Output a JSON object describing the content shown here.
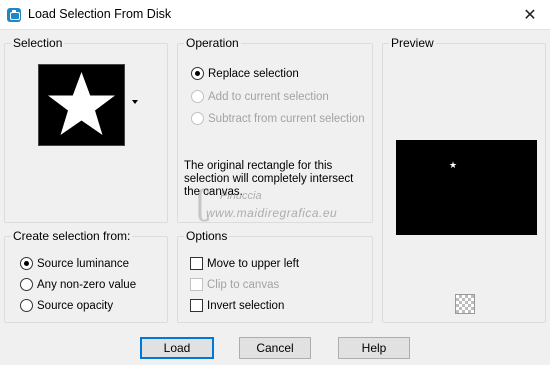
{
  "window": {
    "title": "Load Selection From Disk",
    "close_glyph": "✕",
    "icon": "paintshop-app-icon"
  },
  "selection": {
    "label": "Selection",
    "thumbnail": "white-star-on-black"
  },
  "operation": {
    "label": "Operation",
    "options": [
      {
        "label": "Replace selection",
        "checked": true,
        "enabled": true
      },
      {
        "label": "Add to current selection",
        "checked": false,
        "enabled": false
      },
      {
        "label": "Subtract from current selection",
        "checked": false,
        "enabled": false
      }
    ],
    "info": "The original rectangle for this selection will completely intersect the canvas."
  },
  "preview": {
    "label": "Preview",
    "toggle_icon": "checkerboard-icon"
  },
  "create_from": {
    "label": "Create selection from:",
    "options": [
      {
        "label": "Source luminance",
        "checked": true
      },
      {
        "label": "Any non-zero value",
        "checked": false
      },
      {
        "label": "Source opacity",
        "checked": false
      }
    ]
  },
  "options": {
    "label": "Options",
    "items": [
      {
        "label": "Move to upper left",
        "checked": false,
        "enabled": true
      },
      {
        "label": "Clip to canvas",
        "checked": false,
        "enabled": false
      },
      {
        "label": "Invert selection",
        "checked": false,
        "enabled": true
      }
    ]
  },
  "buttons": {
    "load": "Load",
    "cancel": "Cancel",
    "help": "Help"
  },
  "watermark": {
    "name": "Pinuccia",
    "site": "www.maidiregrafica.eu"
  },
  "colors": {
    "accent": "#0078d7",
    "dialog_bg": "#f0f0f0",
    "disabled_text": "#a3a3a3"
  }
}
